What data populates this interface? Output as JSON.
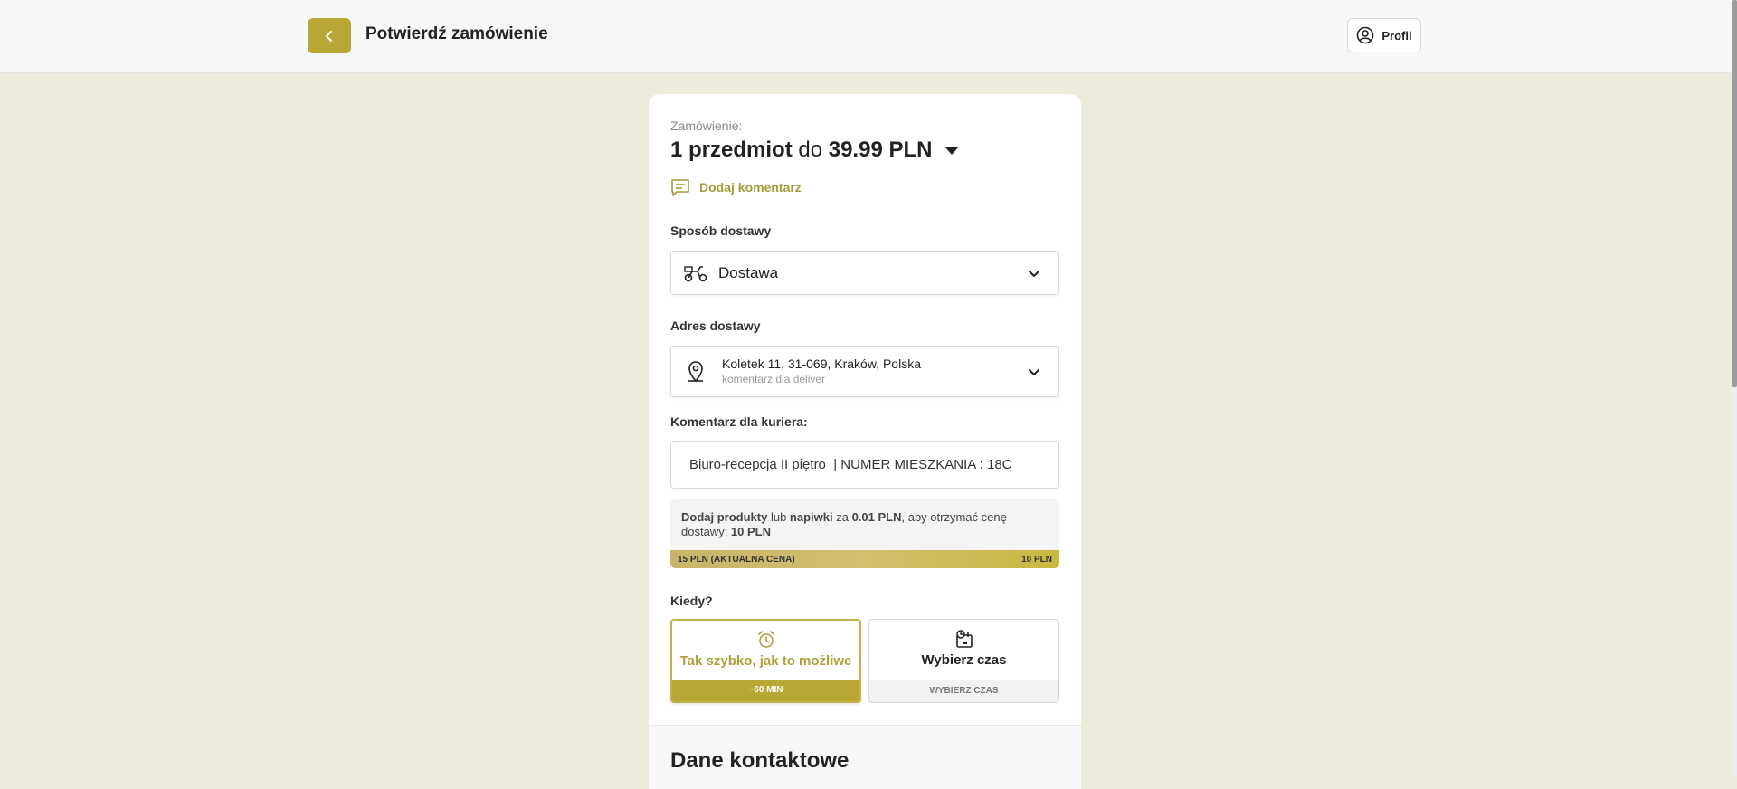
{
  "header": {
    "title": "Potwierdź zamówienie",
    "profile_label": "Profil"
  },
  "order": {
    "label": "Zamówienie:",
    "items": "1 przedmiot",
    "connector": "do",
    "total": "39.99 PLN",
    "add_comment": "Dodaj komentarz"
  },
  "delivery_method": {
    "label": "Sposób dostawy",
    "value": "Dostawa"
  },
  "address": {
    "label": "Adres dostawy",
    "line1": "Koletek 11, 31-069, Kraków, Polska",
    "line2": "komentarz dla deliver"
  },
  "courier_comment": {
    "label": "Komentarz dla kuriera:",
    "value": "Biuro-recepcja II piętro  | NUMER MIESZKANIA : 18C"
  },
  "promo": {
    "p1": "Dodaj produkty",
    "p2": " lub ",
    "p3": "napiwki",
    "p4": " za ",
    "p5": "0.01 PLN",
    "p6": ", aby otrzymać cenę dostawy: ",
    "p7": "10 PLN",
    "bar_left": "15 PLN (AKTUALNA CENA)",
    "bar_right": "10 PLN"
  },
  "when": {
    "label": "Kiedy?",
    "asap_label": "Tak szybko, jak to możliwe",
    "asap_footer": "~60 MIN",
    "pick_label": "Wybierz czas",
    "pick_footer": "WYBIERZ CZAS"
  },
  "contact": {
    "title": "Dane kontaktowe"
  },
  "colors": {
    "accent": "#b8a735",
    "background": "#ecebdc"
  }
}
